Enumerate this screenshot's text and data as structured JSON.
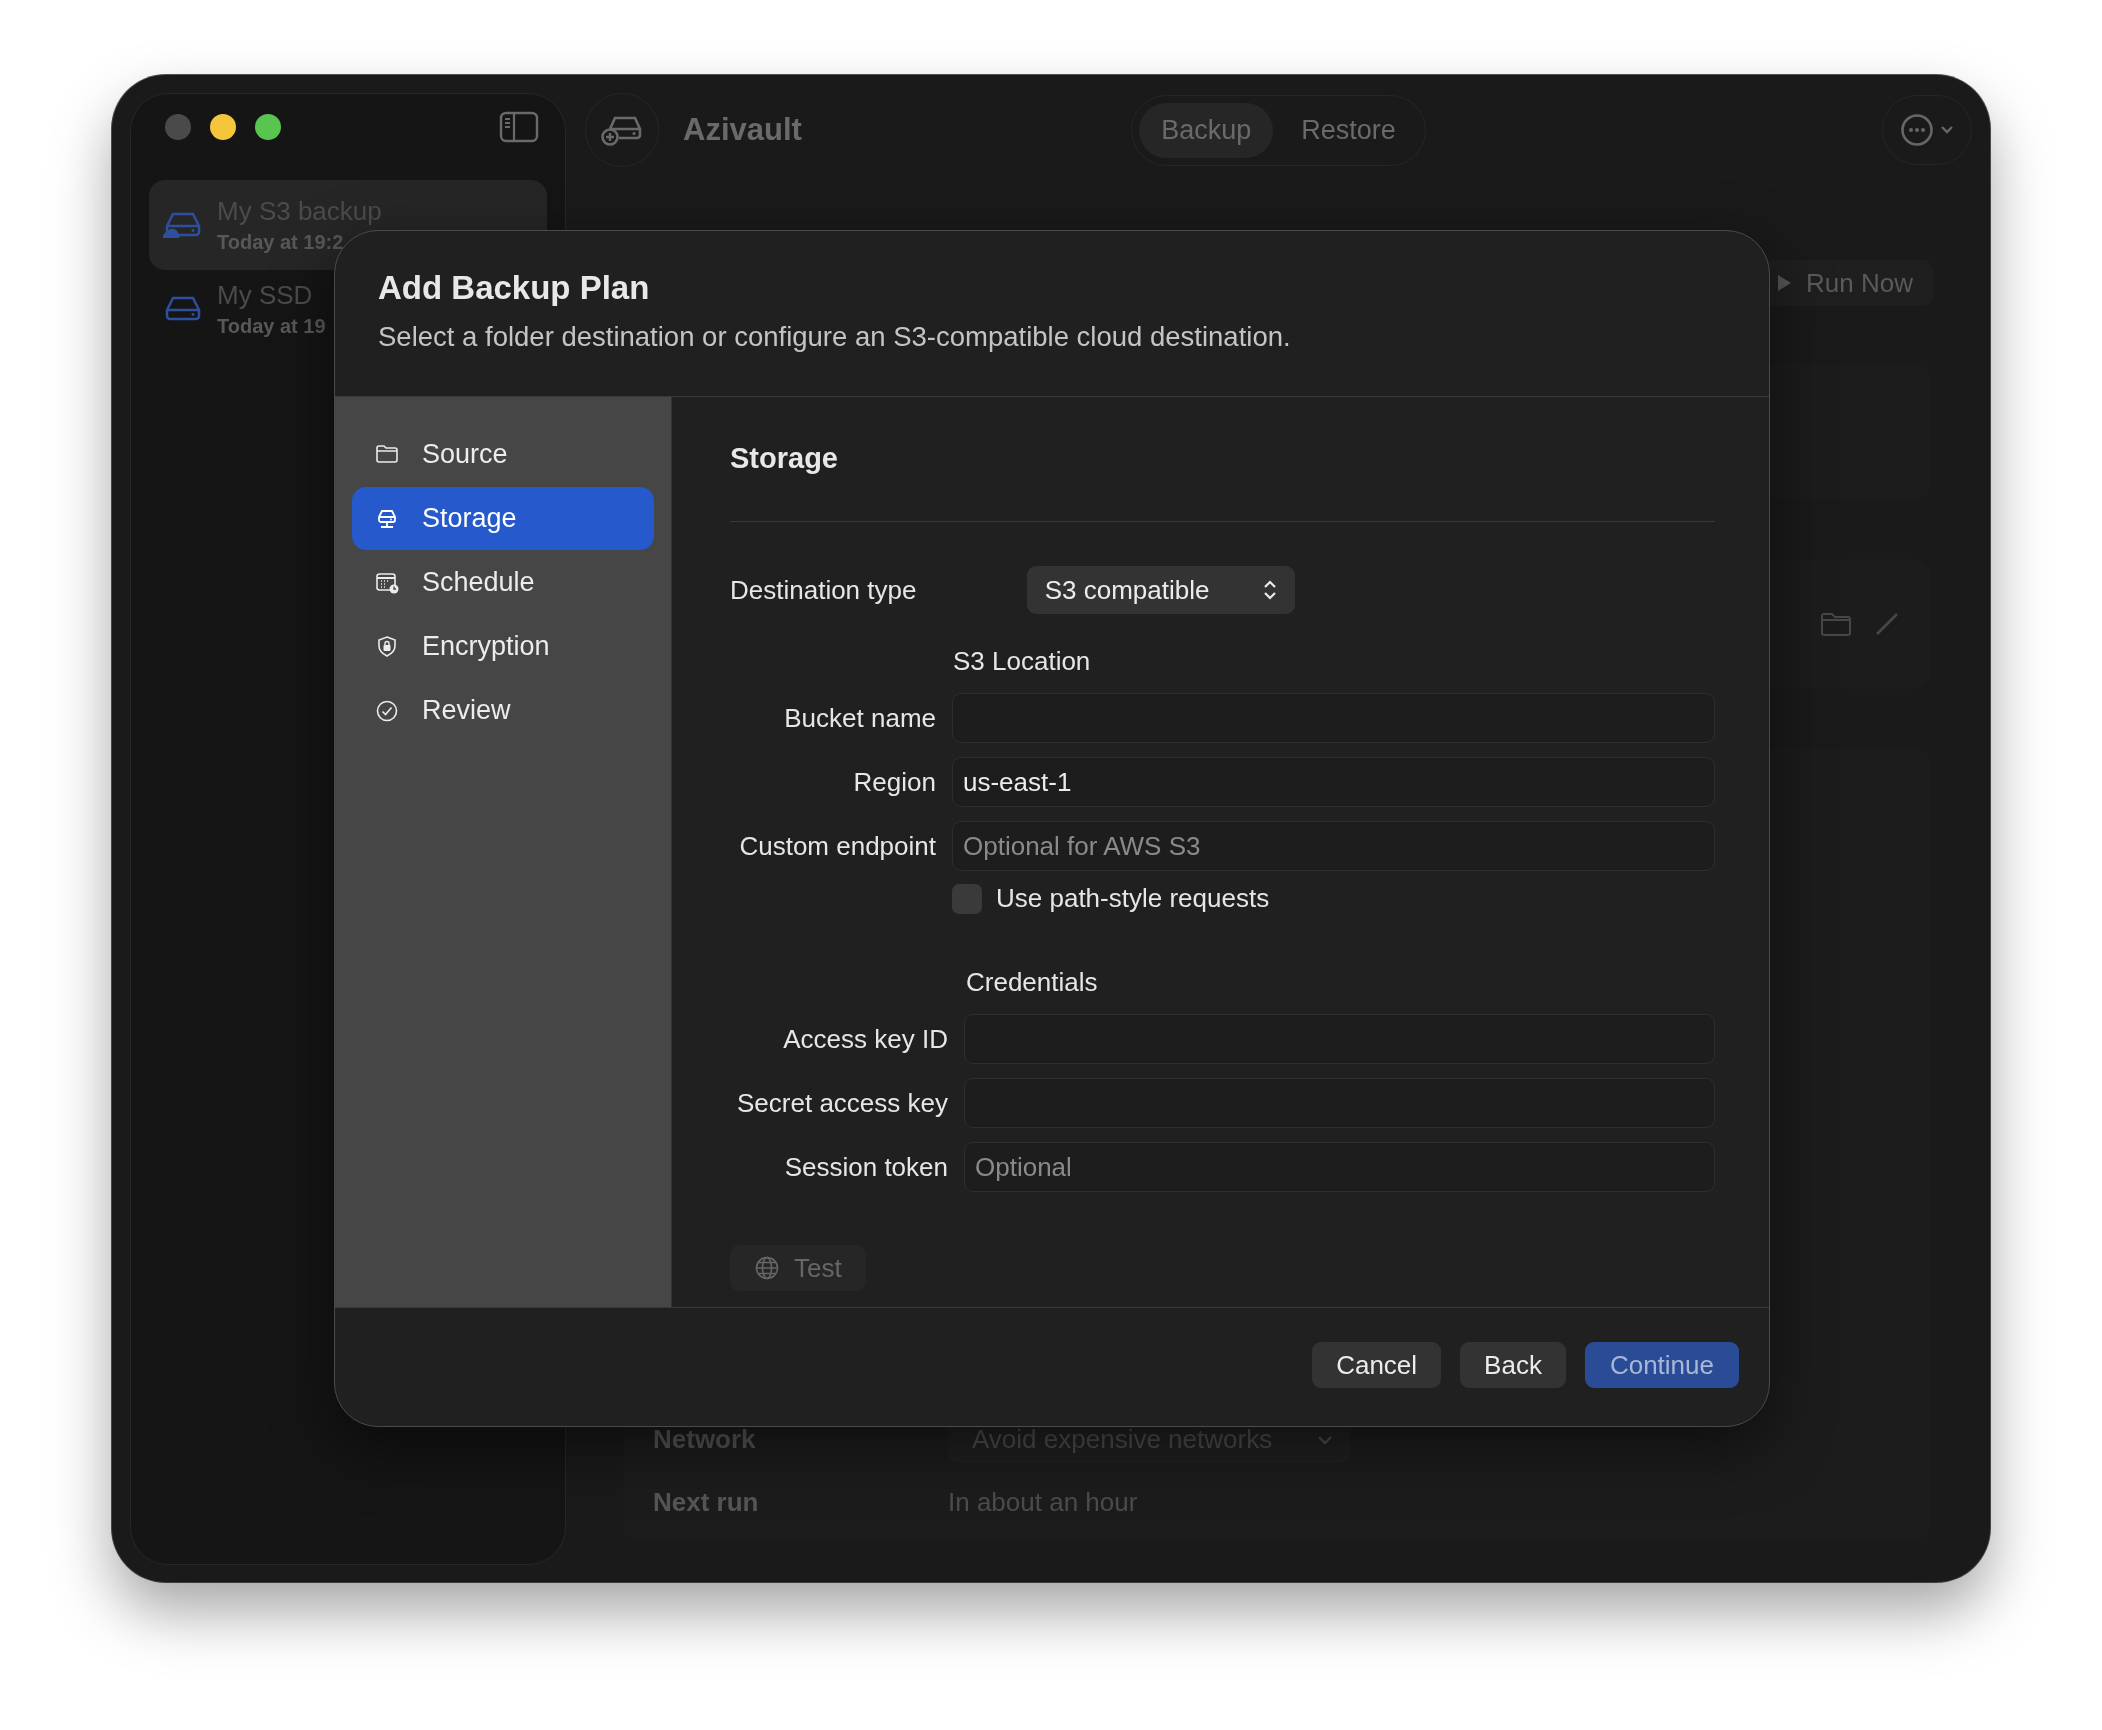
{
  "window": {
    "title": "Azivault",
    "segments": [
      {
        "label": "Backup",
        "selected": true
      },
      {
        "label": "Restore",
        "selected": false
      }
    ]
  },
  "sidebar": {
    "items": [
      {
        "name": "My S3 backup",
        "subtitle": "Today at 19:2",
        "selected": true
      },
      {
        "name": "My SSD",
        "subtitle": "Today at 19",
        "selected": false
      }
    ]
  },
  "main": {
    "run_button": "Run Now",
    "settings": [
      {
        "label": "Network",
        "value": "Avoid expensive networks",
        "kind": "popup"
      },
      {
        "label": "Next run",
        "value": "In about an hour",
        "kind": "text"
      }
    ]
  },
  "dialog": {
    "title": "Add Backup Plan",
    "subtitle": "Select a folder destination or configure an S3-compatible cloud destination.",
    "steps": [
      {
        "label": "Source",
        "selected": false
      },
      {
        "label": "Storage",
        "selected": true
      },
      {
        "label": "Schedule",
        "selected": false
      },
      {
        "label": "Encryption",
        "selected": false
      },
      {
        "label": "Review",
        "selected": false
      }
    ],
    "section_title": "Storage",
    "destination_type": {
      "label": "Destination type",
      "value": "S3 compatible"
    },
    "s3_location": {
      "heading": "S3 Location",
      "fields": [
        {
          "label": "Bucket name"
        },
        {
          "label": "Region",
          "value": "us-east-1"
        },
        {
          "label": "Custom endpoint",
          "placeholder": "Optional for AWS S3"
        }
      ],
      "checkbox": {
        "label": "Use path-style requests",
        "checked": false
      }
    },
    "credentials": {
      "heading": "Credentials",
      "fields": [
        {
          "label": "Access key ID"
        },
        {
          "label": "Secret access key"
        },
        {
          "label": "Session token",
          "placeholder": "Optional"
        }
      ]
    },
    "test_button": {
      "label": "Test",
      "disabled": true
    },
    "buttons": [
      {
        "label": "Cancel",
        "kind": "normal"
      },
      {
        "label": "Back",
        "kind": "normal"
      },
      {
        "label": "Continue",
        "kind": "primary"
      }
    ]
  }
}
